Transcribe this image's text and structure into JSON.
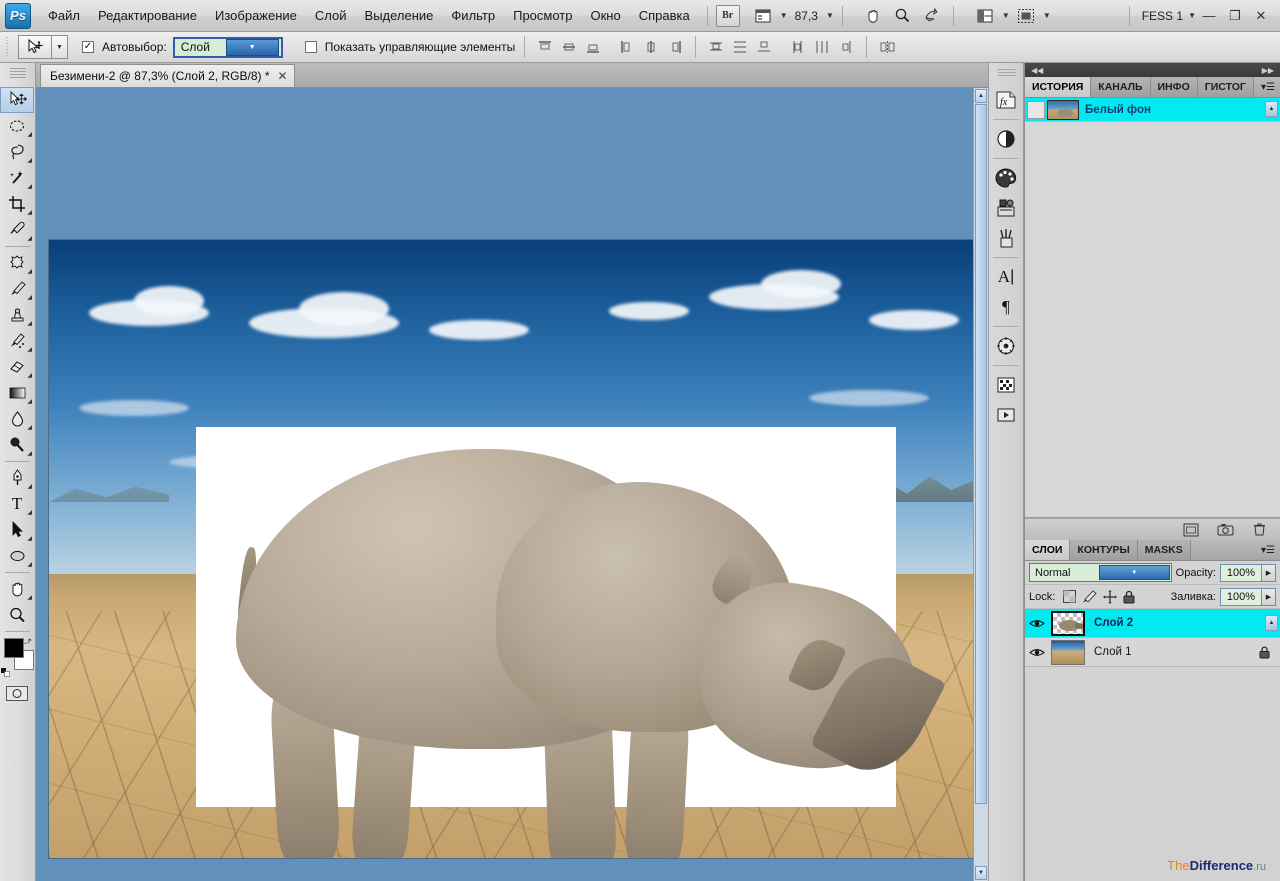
{
  "app": {
    "logo": "Ps",
    "workspace": "FESS 1",
    "zoom": "87,3",
    "bridge_label": "Br"
  },
  "menubar": {
    "items": [
      {
        "label": "Файл",
        "name": "menu-file"
      },
      {
        "label": "Редактирование",
        "name": "menu-edit"
      },
      {
        "label": "Изображение",
        "name": "menu-image"
      },
      {
        "label": "Слой",
        "name": "menu-layer"
      },
      {
        "label": "Выделение",
        "name": "menu-select"
      },
      {
        "label": "Фильтр",
        "name": "menu-filter"
      },
      {
        "label": "Просмотр",
        "name": "menu-view"
      },
      {
        "label": "Окно",
        "name": "menu-window"
      },
      {
        "label": "Справка",
        "name": "menu-help"
      }
    ],
    "window_buttons": {
      "minimize": "—",
      "maximize": "❐",
      "close": "✕"
    }
  },
  "options_bar": {
    "auto_select_checked": "☑",
    "auto_select_label": "Автовыбор:",
    "auto_select_value": "Слой",
    "show_controls_checked": "☐",
    "show_controls_label": "Показать управляющие элементы"
  },
  "document": {
    "tab_title": "Безимени-2 @ 87,3% (Слой 2, RGB/8) *",
    "close_glyph": "✕"
  },
  "history_panel": {
    "tabs": [
      {
        "label": "ИСТОРИЯ",
        "selected": true
      },
      {
        "label": "КАНАЛЬ",
        "selected": false
      },
      {
        "label": "ИНФО",
        "selected": false
      },
      {
        "label": "ГИСТОГ",
        "selected": false
      }
    ],
    "items": [
      {
        "label": "Белый фон",
        "selected": true
      }
    ]
  },
  "layers_panel": {
    "tabs": [
      {
        "label": "СЛОИ",
        "selected": true
      },
      {
        "label": "КОНТУРЫ",
        "selected": false
      },
      {
        "label": "MASKS",
        "selected": false
      }
    ],
    "blend_mode": "Normal",
    "opacity_label": "Opacity:",
    "opacity_value": "100%",
    "lock_label": "Lock:",
    "fill_label": "Заливка:",
    "fill_value": "100%",
    "layers": [
      {
        "name": "Слой 2",
        "selected": true,
        "locked": false,
        "visible": true
      },
      {
        "name": "Слой 1",
        "selected": false,
        "locked": true,
        "visible": true
      }
    ]
  },
  "toolbar": {
    "tools": [
      {
        "name": "move-tool",
        "glyph": "move",
        "active": true
      },
      {
        "name": "marquee-tool",
        "glyph": "ellipse"
      },
      {
        "name": "lasso-tool",
        "glyph": "lasso"
      },
      {
        "name": "magic-wand-tool",
        "glyph": "wand"
      },
      {
        "name": "crop-tool",
        "glyph": "crop"
      },
      {
        "name": "eyedropper-tool",
        "glyph": "dropper"
      },
      {
        "name": "healing-brush-tool",
        "glyph": "heal"
      },
      {
        "name": "brush-tool",
        "glyph": "brush"
      },
      {
        "name": "clone-stamp-tool",
        "glyph": "stamp"
      },
      {
        "name": "history-brush-tool",
        "glyph": "histbrush"
      },
      {
        "name": "eraser-tool",
        "glyph": "eraser"
      },
      {
        "name": "gradient-tool",
        "glyph": "gradient"
      },
      {
        "name": "blur-tool",
        "glyph": "blur"
      },
      {
        "name": "dodge-tool",
        "glyph": "dodge"
      },
      {
        "name": "pen-tool",
        "glyph": "pen"
      },
      {
        "name": "type-tool",
        "glyph": "T"
      },
      {
        "name": "path-selection-tool",
        "glyph": "arrow"
      },
      {
        "name": "shape-tool",
        "glyph": "shape"
      },
      {
        "name": "hand-tool",
        "glyph": "hand"
      },
      {
        "name": "zoom-tool",
        "glyph": "zoom"
      }
    ],
    "foreground_color": "#000000",
    "background_color": "#ffffff"
  },
  "icon_dock": {
    "buttons": [
      {
        "name": "styles-icon",
        "glyph": "fx"
      },
      {
        "name": "adjustments-icon",
        "glyph": "half"
      },
      {
        "name": "color-icon",
        "glyph": "palette"
      },
      {
        "name": "swatches-icon",
        "glyph": "swatch"
      },
      {
        "name": "brushes-icon",
        "glyph": "brushcan"
      },
      {
        "name": "character-icon",
        "glyph": "A"
      },
      {
        "name": "paragraph-icon",
        "glyph": "¶"
      },
      {
        "name": "navigator-icon",
        "glyph": "compass"
      },
      {
        "name": "tool-presets-icon",
        "glyph": "grid"
      },
      {
        "name": "actions-icon",
        "glyph": "play"
      }
    ]
  },
  "watermark": {
    "the": "The",
    "difference": "Difference",
    "ru": ".ru"
  },
  "colors": {
    "canvas_background": "#6190ba",
    "selection_highlight": "#00eaf0",
    "panel_background": "#d2d2d2",
    "accent_blue": "#2766ad"
  }
}
